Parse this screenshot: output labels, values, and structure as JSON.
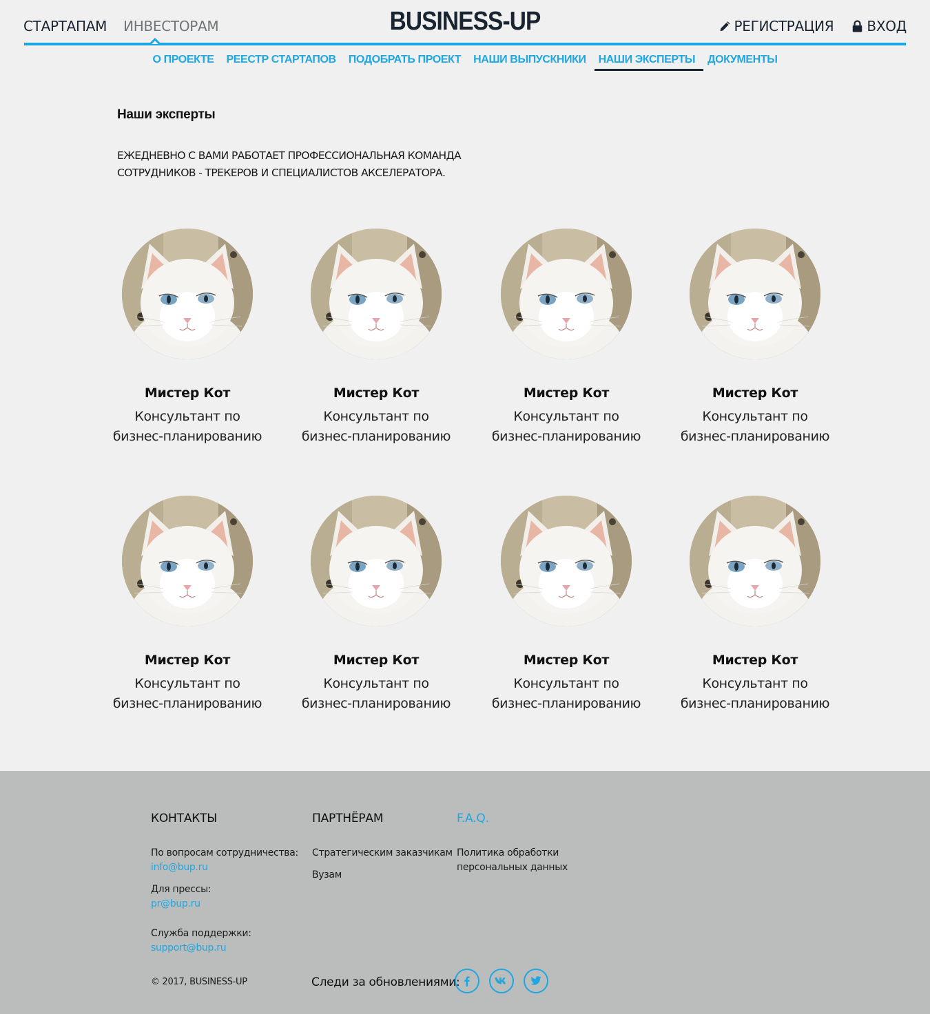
{
  "header": {
    "left_tabs": [
      "СТАРТАПАМ",
      "ИНВЕСТОРАМ"
    ],
    "logo": "BUSINESS-UP",
    "register": "РЕГИСТРАЦИЯ",
    "login": "ВХОД",
    "register_icon": "pencil-icon",
    "login_icon": "lock-icon"
  },
  "subnav": [
    "О ПРОЕКТЕ",
    "РЕЕСТР СТАРТАПОВ",
    "ПОДОБРАТЬ ПРОЕКТ",
    "НАШИ ВЫПУСКНИКИ",
    "НАШИ ЭКСПЕРТЫ",
    "ДОКУМЕНТЫ"
  ],
  "subnav_active": "НАШИ ЭКСПЕРТЫ",
  "main": {
    "title": "Наши эксперты",
    "intro_line1": "ЕЖЕДНЕВНО С ВАМИ  РАБОТАЕТ ПРОФЕССИОНАЛЬНАЯ КОМАНДА",
    "intro_line2": "СОТРУДНИКОВ - ТРЕКЕРОВ И СПЕЦИАЛИСТОВ АКСЕЛЕРАТОРА."
  },
  "experts": [
    {
      "name": "Мистер Кот",
      "role_line1": "Консультант по",
      "role_line2": "бизнес-планированию"
    },
    {
      "name": "Мистер Кот",
      "role_line1": "Консультант по",
      "role_line2": "бизнес-планированию"
    },
    {
      "name": "Мистер Кот",
      "role_line1": "Консультант по",
      "role_line2": "бизнес-планированию"
    },
    {
      "name": "Мистер Кот",
      "role_line1": "Консультант по",
      "role_line2": "бизнес-планированию"
    },
    {
      "name": "Мистер Кот",
      "role_line1": "Консультант по",
      "role_line2": "бизнес-планированию"
    },
    {
      "name": "Мистер Кот",
      "role_line1": "Консультант по",
      "role_line2": "бизнес-планированию"
    },
    {
      "name": "Мистер Кот",
      "role_line1": "Консультант по",
      "role_line2": "бизнес-планированию"
    },
    {
      "name": "Мистер Кот",
      "role_line1": "Консультант по",
      "role_line2": "бизнес-планированию"
    }
  ],
  "footer": {
    "contacts": {
      "title": "КОНТАКТЫ",
      "coop_label": "По вопросам сотрудничества:",
      "coop_email": "info@bup.ru",
      "press_label": "Для прессы:",
      "press_email": "pr@bup.ru",
      "support_label": "Служба поддержки:",
      "support_email": "support@bup.ru"
    },
    "partners": {
      "title": "ПАРТНЁРАМ",
      "items": [
        "Стратегическим заказчикам",
        "Вузам"
      ]
    },
    "faq": {
      "title": "F.A.Q.",
      "policy_line1": "Политика обработки",
      "policy_line2": "персональных данных"
    },
    "social_label": "Следи за обновлениями:",
    "social_icons": [
      "facebook-icon",
      "vk-icon",
      "twitter-icon"
    ],
    "copyright": "© 2017, BUSINESS-UP"
  },
  "colors": {
    "accent": "#1ea7e1",
    "dark": "#1a2430",
    "background": "#f0f0f0",
    "footer": "#bbbcbc"
  }
}
